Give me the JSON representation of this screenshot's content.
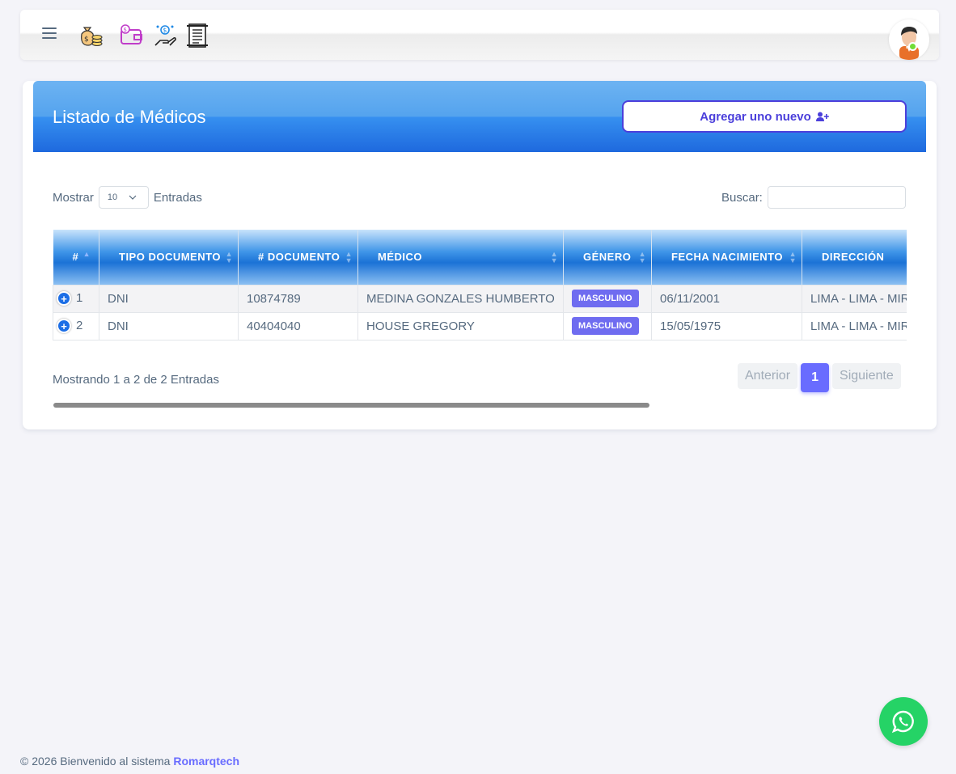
{
  "navbar": {
    "icons": [
      "money-bag-icon",
      "wallet-icon",
      "payment-hand-icon",
      "receipt-icon"
    ],
    "avatar_status_color": "#71dd37"
  },
  "card": {
    "title": "Listado de Médicos",
    "add_button_label": "Agregar uno nuevo"
  },
  "controls": {
    "show_label": "Mostrar",
    "length_value": "10",
    "entries_label": "Entradas",
    "search_label": "Buscar:",
    "search_value": ""
  },
  "table": {
    "columns": [
      "#",
      "TIPO DOCUMENTO",
      "# DOCUMENTO",
      "MÉDICO",
      "GÉNERO",
      "FECHA NACIMIENTO",
      "DIRECCIÓN"
    ],
    "rows": [
      {
        "num": "1",
        "tipo": "DNI",
        "documento": "10874789",
        "medico": "MEDINA GONZALES HUMBERTO",
        "genero": "MASCULINO",
        "fecha": "06/11/2001",
        "direccion": "LIMA - LIMA - MIR"
      },
      {
        "num": "2",
        "tipo": "DNI",
        "documento": "40404040",
        "medico": "HOUSE GREGORY",
        "genero": "MASCULINO",
        "fecha": "15/05/1975",
        "direccion": "LIMA - LIMA - MIR"
      }
    ]
  },
  "info": "Mostrando 1 a 2 de 2 Entradas",
  "pagination": {
    "prev": "Anterior",
    "current": "1",
    "next": "Siguiente"
  },
  "footer": {
    "text": "© 2026 Bienvenido al sistema",
    "brand": "Romarqtech"
  },
  "colors": {
    "accent": "#696cff",
    "header_blue": "#1e69de",
    "badge": "#6f6cf0",
    "whatsapp": "#25d366"
  }
}
